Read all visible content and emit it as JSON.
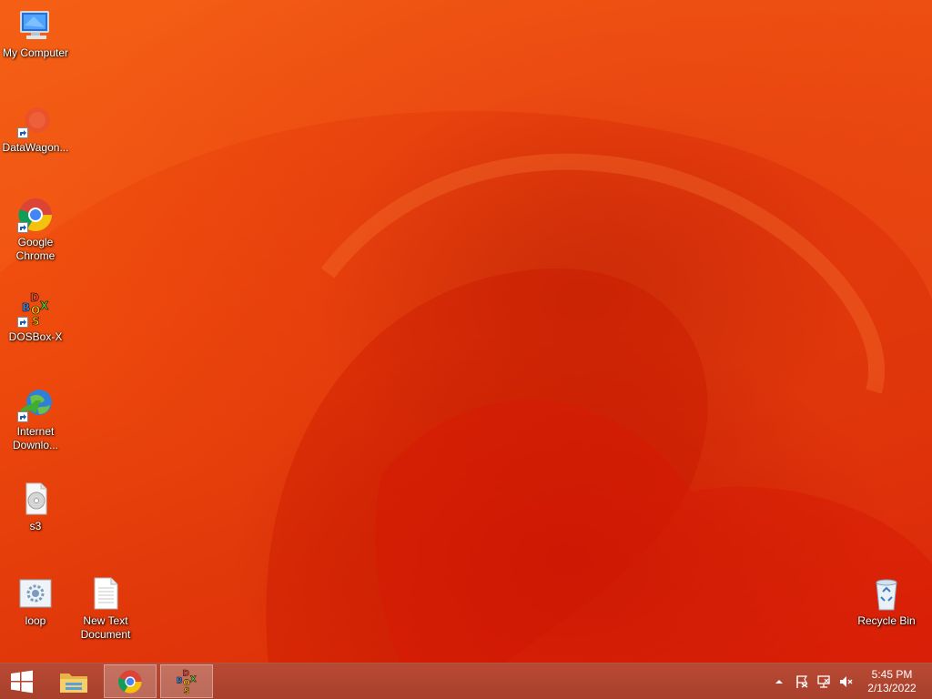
{
  "desktop_icons": {
    "my_computer": "My Computer",
    "datawagon": "DataWagon...",
    "chrome": "Google\nChrome",
    "dosbox": "DOSBox-X",
    "idm": "Internet\nDownlo...",
    "s3": "s3",
    "loop": "loop",
    "new_text": "New Text\nDocument",
    "recycle_bin": "Recycle Bin"
  },
  "taskbar": {
    "items": [
      "Start",
      "File Explorer",
      "Google Chrome",
      "DOSBox-X"
    ],
    "clock_time": "5:45 PM",
    "clock_date": "2/13/2022"
  },
  "colors": {
    "wallpaper": "#ee4a0d",
    "taskbar": "#b04530"
  }
}
